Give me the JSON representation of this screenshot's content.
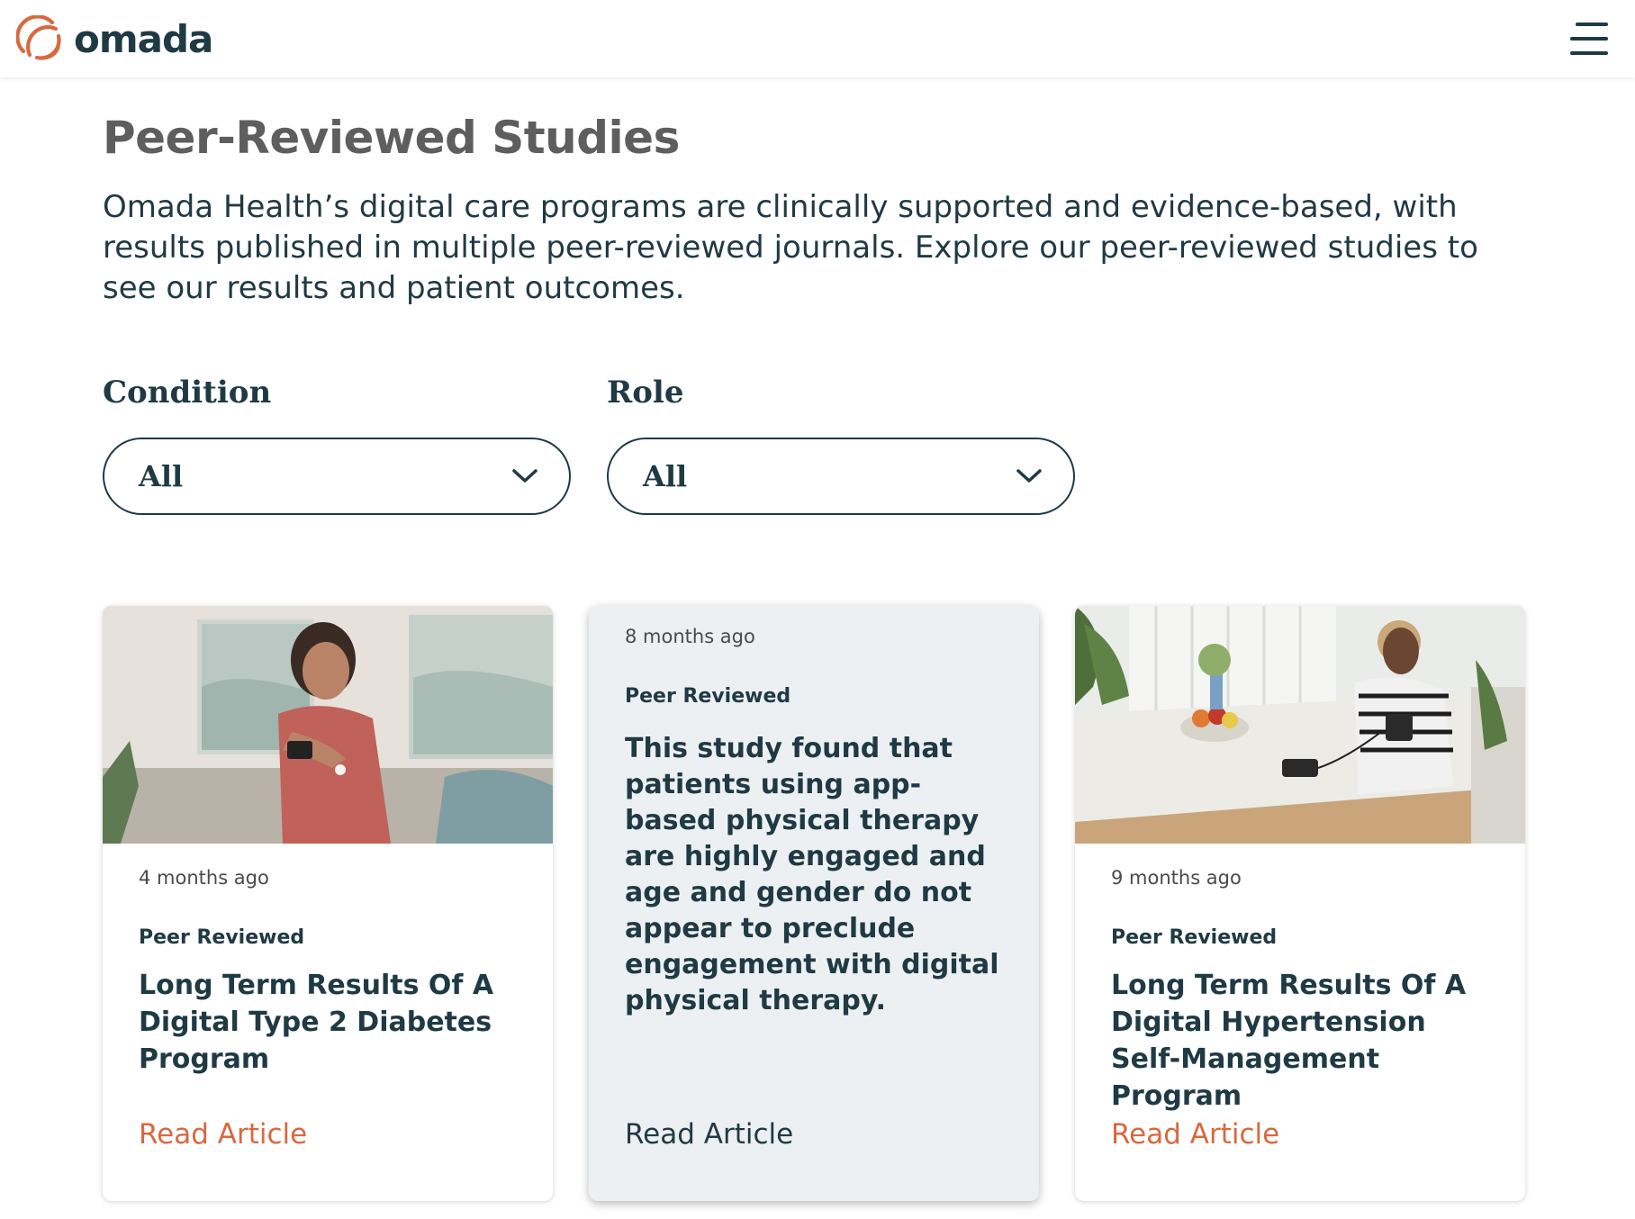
{
  "header": {
    "logo_text": "omada",
    "menu_icon": "hamburger-menu-icon"
  },
  "colors": {
    "brand_orange": "#d9683f",
    "navy": "#1f3a44",
    "title_gray": "#5e5e5e",
    "highlight_card_bg": "#edf0f2"
  },
  "page": {
    "title": "Peer-Reviewed Studies",
    "intro": "Omada Health’s digital care programs are clinically supported and evidence-based, with results published in multiple peer-reviewed journals. Explore our peer-reviewed studies to see our results and patient outcomes."
  },
  "filters": {
    "condition": {
      "label": "Condition",
      "value": "All"
    },
    "role": {
      "label": "Role",
      "value": "All"
    }
  },
  "cards": [
    {
      "time": "4 months ago",
      "tag": "Peer Reviewed",
      "title": "Long Term Results Of A Digital Type 2 Diabetes Program",
      "link": "Read Article",
      "image": "woman-scanning-glucose-sensor-photo"
    },
    {
      "time": "8 months ago",
      "tag": "Peer Reviewed",
      "title": "This study found that patients using app-based physical therapy are highly engaged and age and gender do not appear to preclude engagement with digital physical therapy.",
      "link": "Read Article"
    },
    {
      "time": "9 months ago",
      "tag": "Peer Reviewed",
      "title": "Long Term Results Of A Digital Hypertension Self-Management Program",
      "link": "Read Article",
      "image": "woman-measuring-blood-pressure-photo"
    }
  ]
}
